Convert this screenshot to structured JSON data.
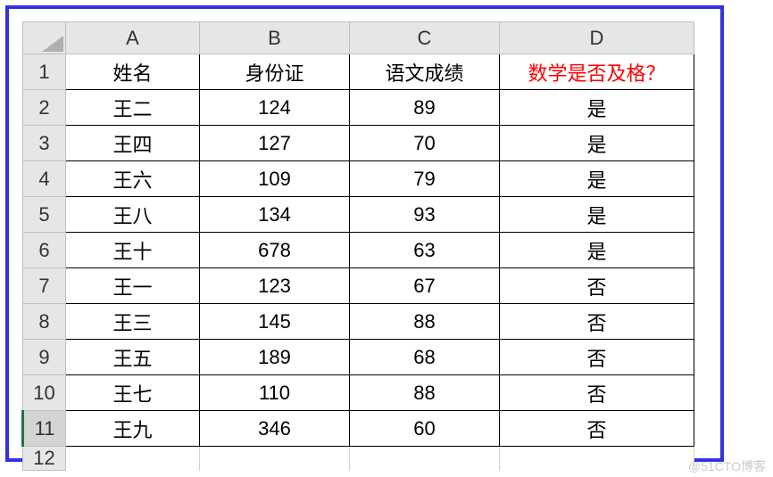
{
  "columns": [
    "A",
    "B",
    "C",
    "D"
  ],
  "row_numbers": [
    "1",
    "2",
    "3",
    "4",
    "5",
    "6",
    "7",
    "8",
    "9",
    "10",
    "11"
  ],
  "partial_row": "12",
  "selected_row_index": 10,
  "headers": {
    "A": "姓名",
    "B": "身份证",
    "C": "语文成绩",
    "D": "数学是否及格？"
  },
  "header_d_color": "#ff0000",
  "rows": [
    {
      "A": "王二",
      "B": "124",
      "C": "89",
      "D": "是"
    },
    {
      "A": "王四",
      "B": "127",
      "C": "70",
      "D": "是"
    },
    {
      "A": "王六",
      "B": "109",
      "C": "79",
      "D": "是"
    },
    {
      "A": "王八",
      "B": "134",
      "C": "93",
      "D": "是"
    },
    {
      "A": "王十",
      "B": "678",
      "C": "63",
      "D": "是"
    },
    {
      "A": "王一",
      "B": "123",
      "C": "67",
      "D": "否"
    },
    {
      "A": "王三",
      "B": "145",
      "C": "88",
      "D": "否"
    },
    {
      "A": "王五",
      "B": "189",
      "C": "68",
      "D": "否"
    },
    {
      "A": "王七",
      "B": "110",
      "C": "88",
      "D": "否"
    },
    {
      "A": "王九",
      "B": "346",
      "C": "60",
      "D": "否"
    }
  ],
  "watermark": "@51CTO博客"
}
